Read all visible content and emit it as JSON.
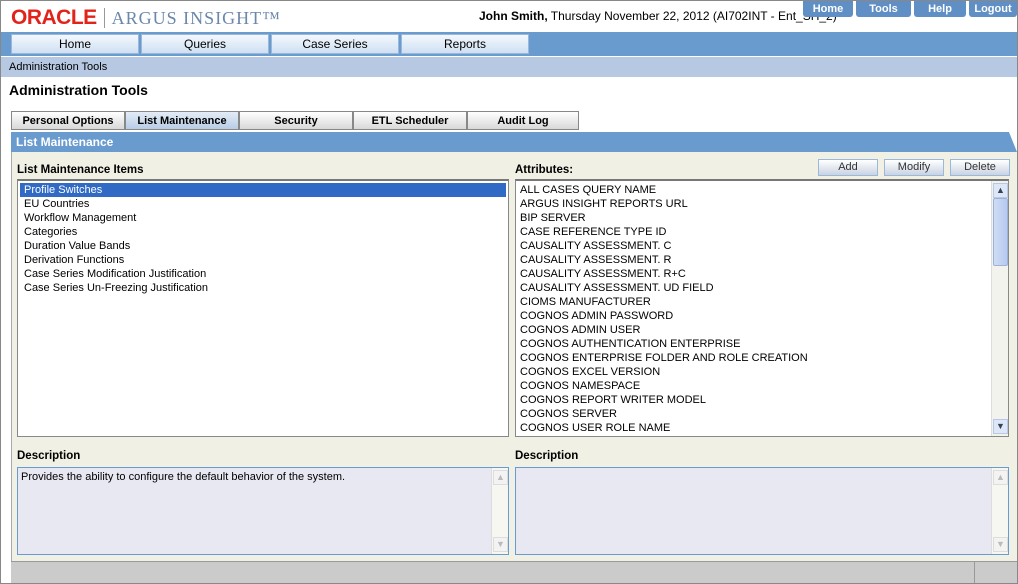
{
  "header": {
    "brand": "ORACLE",
    "product": "ARGUS INSIGHT™",
    "user": "John Smith,",
    "date_info": " Thursday November 22, 2012 (AI702INT - Ent_SH_2)",
    "top_links": [
      "Home",
      "Tools",
      "Help",
      "Logout"
    ]
  },
  "nav": [
    "Home",
    "Queries",
    "Case Series",
    "Reports"
  ],
  "breadcrumb": "Administration Tools",
  "page_title": "Administration Tools",
  "tabs": [
    "Personal Options",
    "List Maintenance",
    "Security",
    "ETL Scheduler",
    "Audit Log"
  ],
  "selected_tab": "List Maintenance",
  "section_title": "List Maintenance",
  "items_label": "List Maintenance Items",
  "items": [
    "Profile Switches",
    "EU Countries",
    "Workflow Management",
    "Categories",
    "Duration Value Bands",
    "Derivation Functions",
    "Case Series Modification Justification",
    "Case Series Un-Freezing Justification"
  ],
  "selected_item": "Profile Switches",
  "attributes_label": "Attributes:",
  "buttons": {
    "add": "Add",
    "modify": "Modify",
    "delete": "Delete"
  },
  "attributes": [
    "ALL CASES QUERY NAME",
    "ARGUS INSIGHT REPORTS URL",
    "BIP SERVER",
    "CASE REFERENCE TYPE ID",
    "CAUSALITY ASSESSMENT. C",
    "CAUSALITY ASSESSMENT. R",
    "CAUSALITY ASSESSMENT. R+C",
    "CAUSALITY ASSESSMENT. UD FIELD",
    "CIOMS MANUFACTURER",
    "COGNOS ADMIN PASSWORD",
    "COGNOS ADMIN USER",
    "COGNOS AUTHENTICATION ENTERPRISE",
    "COGNOS ENTERPRISE FOLDER AND ROLE CREATION",
    "COGNOS EXCEL VERSION",
    "COGNOS NAMESPACE",
    "COGNOS REPORT WRITER MODEL",
    "COGNOS SERVER",
    "COGNOS USER ROLE NAME"
  ],
  "description_left": {
    "label": "Description",
    "text": "Provides the ability to configure the default behavior of the system."
  },
  "description_right": {
    "label": "Description",
    "text": ""
  },
  "colors": {
    "brand_red": "#e2231a",
    "nav_blue": "#6a9bcf",
    "selection": "#316ac5"
  }
}
